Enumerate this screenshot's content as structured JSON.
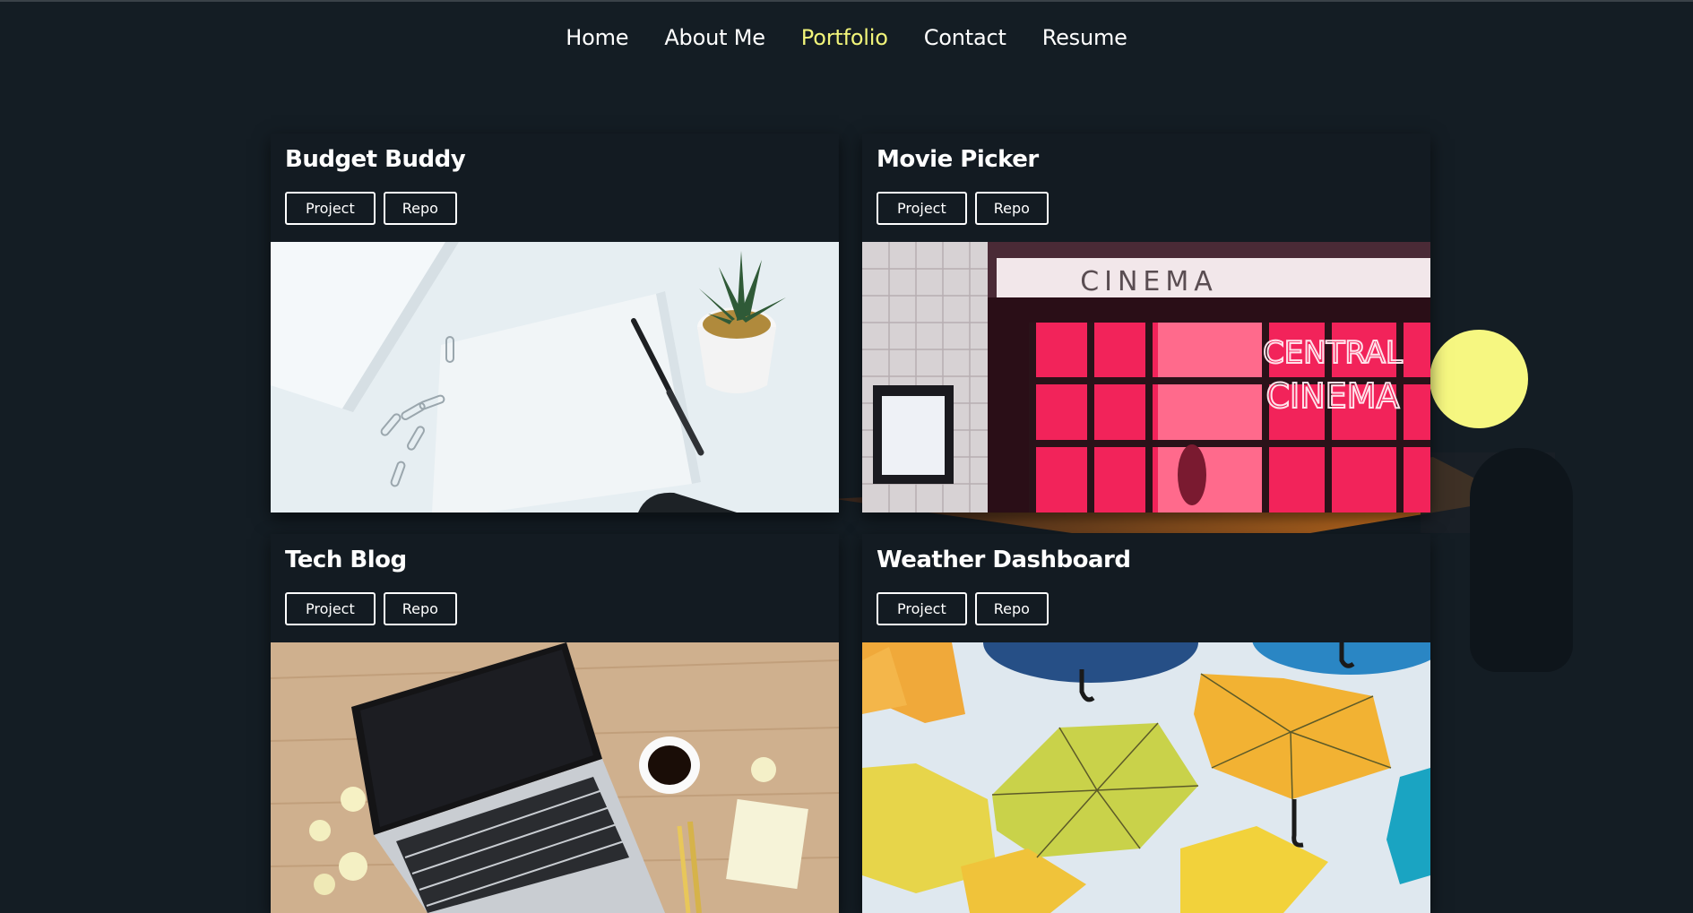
{
  "nav": {
    "items": [
      {
        "label": "Home",
        "active": false
      },
      {
        "label": "About Me",
        "active": false
      },
      {
        "label": "Portfolio",
        "active": true
      },
      {
        "label": "Contact",
        "active": false
      },
      {
        "label": "Resume",
        "active": false
      }
    ]
  },
  "projects": [
    {
      "title": "Budget Buddy",
      "project_label": "Project",
      "repo_label": "Repo"
    },
    {
      "title": "Movie Picker",
      "project_label": "Project",
      "repo_label": "Repo",
      "sign_text_1": "CINEMA",
      "sign_text_2": "CENTRAL",
      "sign_text_3": "CINEMA"
    },
    {
      "title": "Tech Blog",
      "project_label": "Project",
      "repo_label": "Repo"
    },
    {
      "title": "Weather Dashboard",
      "project_label": "Project",
      "repo_label": "Repo"
    }
  ],
  "colors": {
    "background": "#141d24",
    "card": "#131b22",
    "accent_active_nav": "#f2f57a",
    "deco_circle": "#f6f781",
    "deco_triangle": "#d9781e"
  }
}
